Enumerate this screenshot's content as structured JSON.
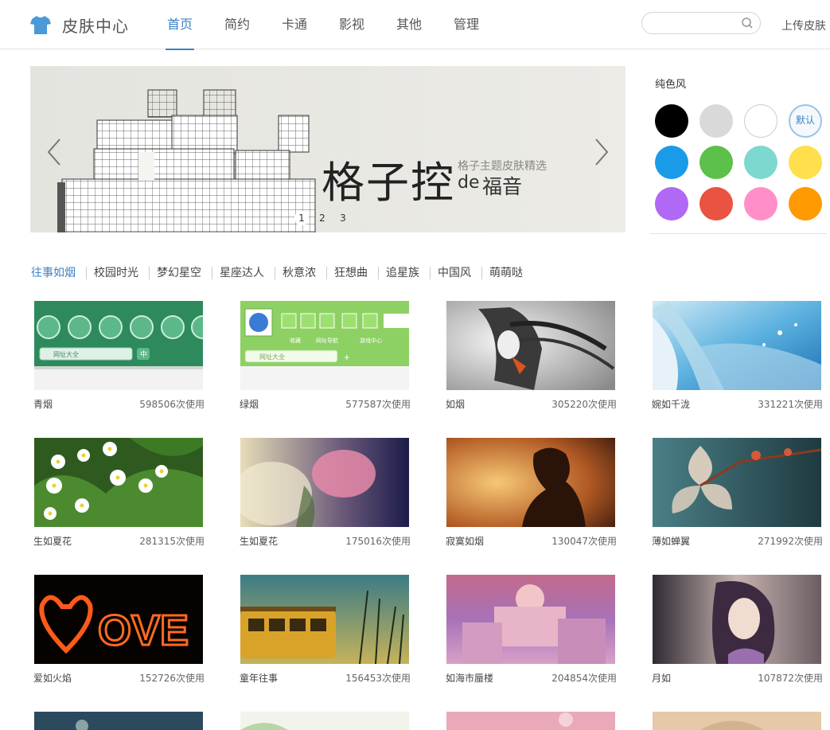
{
  "header": {
    "brand": "皮肤中心",
    "nav": [
      "首页",
      "简约",
      "卡通",
      "影视",
      "其他",
      "管理"
    ],
    "search_placeholder": "",
    "upload_label": "上传皮肤"
  },
  "banner": {
    "title": "格子控",
    "subtitle": "格子主题皮肤精选",
    "de": "de",
    "tagline": "福音",
    "pages": [
      "1",
      "2",
      "3"
    ],
    "active_page": "1"
  },
  "palette": {
    "title": "纯色风",
    "default_label": "默认",
    "colors": [
      "#000000",
      "#d9d9d9",
      "#ffffff",
      "default",
      "#1a9be8",
      "#5cc04a",
      "#7dd8d0",
      "#ffdf4b",
      "#b068f5",
      "#e9533f",
      "#ff8fc6",
      "#ff9a00"
    ]
  },
  "categories": {
    "active": "往事如烟",
    "items": [
      "往事如烟",
      "校园时光",
      "梦幻星空",
      "星座达人",
      "秋意浓",
      "狂想曲",
      "追星族",
      "中国风",
      "萌萌哒"
    ]
  },
  "skins": [
    {
      "name": "青烟",
      "count": "598506次使用"
    },
    {
      "name": "绿烟",
      "count": "577587次使用"
    },
    {
      "name": "如烟",
      "count": "305220次使用"
    },
    {
      "name": "婉如千泷",
      "count": "331221次使用"
    },
    {
      "name": "生如夏花",
      "count": "281315次使用"
    },
    {
      "name": "生如夏花",
      "count": "175016次使用"
    },
    {
      "name": "寂寞如烟",
      "count": "130047次使用"
    },
    {
      "name": "薄如蝉翼",
      "count": "271992次使用"
    },
    {
      "name": "爱如火焰",
      "count": "152726次使用"
    },
    {
      "name": "童年往事",
      "count": "156453次使用"
    },
    {
      "name": "如海市蜃楼",
      "count": "204854次使用"
    },
    {
      "name": "月如",
      "count": "107872次使用"
    }
  ],
  "thumb_texts": {
    "addr_box": "网址大全",
    "zh": "中",
    "fav": "收藏",
    "nav_link": "网址导航",
    "game": "游戏中心",
    "ove": "OVE"
  }
}
